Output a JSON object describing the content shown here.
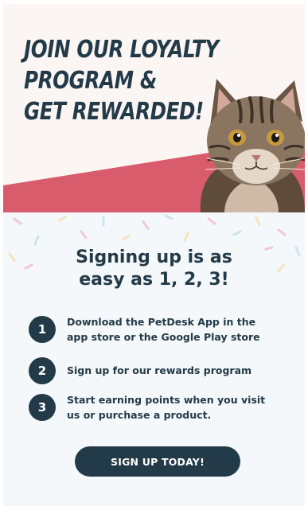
{
  "hero": {
    "title_lines": [
      "JOIN OUR LOYALTY",
      "PROGRAM &",
      "GET REWARDED!"
    ]
  },
  "signup": {
    "heading_lines": [
      "Signing up is as",
      "easy as 1, 2, 3!"
    ],
    "steps": [
      {
        "number": "1",
        "lines": [
          "Download the PetDesk App in the",
          "app store or the Google Play store"
        ]
      },
      {
        "number": "2",
        "lines": [
          "Sign up for our rewards program"
        ]
      },
      {
        "number": "3",
        "lines": [
          "Start earning points when you visit",
          "us or purchase a product."
        ]
      }
    ],
    "cta_label": "SIGN UP TODAY!"
  },
  "colors": {
    "navy": "#233a48",
    "pink": "#d95c6c",
    "hero_bg": "#fbf6f4",
    "panel_bg": "#f4f8fa"
  }
}
